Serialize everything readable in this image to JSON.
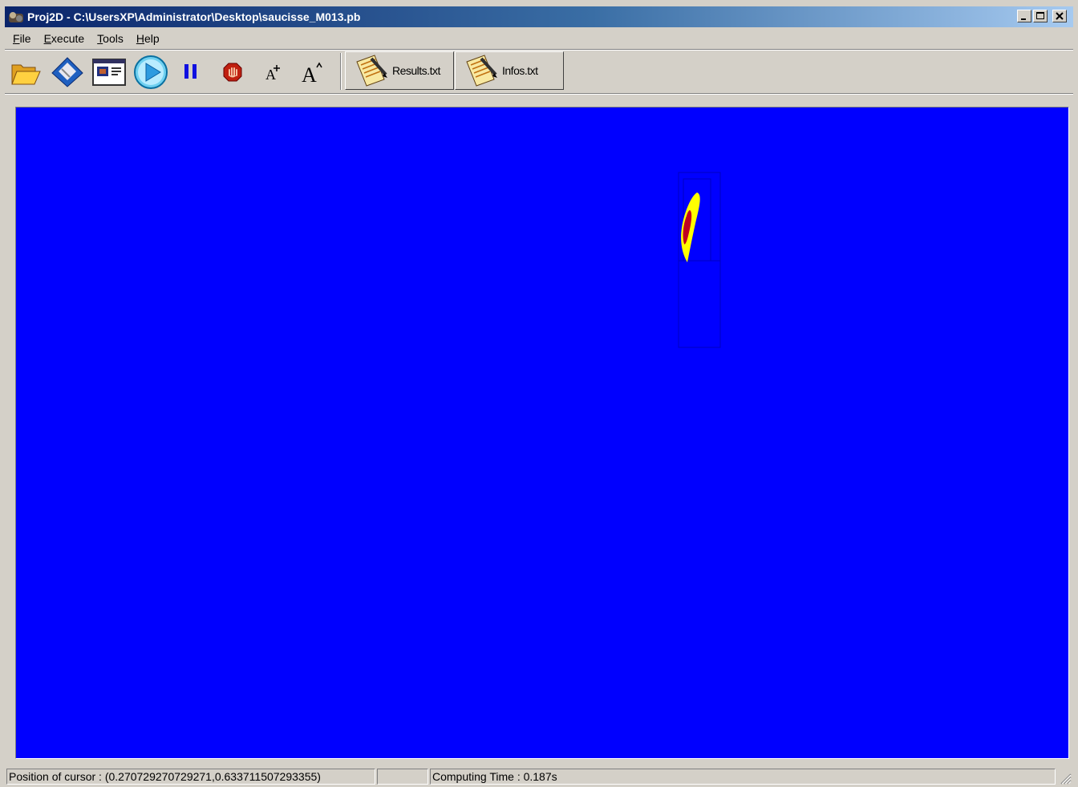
{
  "window": {
    "title": "Proj2D - C:\\UsersXP\\Administrator\\Desktop\\saucisse_M013.pb",
    "minimize_icon": "minimize-icon",
    "maximize_icon": "maximize-icon",
    "close_icon": "close-icon"
  },
  "menu": {
    "file": "File",
    "execute": "Execute",
    "tools": "Tools",
    "help": "Help"
  },
  "toolbar": {
    "open_icon": "folder-open-icon",
    "save_icon": "floppy-disk-icon",
    "display_icon": "display-window-icon",
    "run_icon": "play-icon",
    "pause_icon": "pause-icon",
    "stop_icon": "stop-hand-icon",
    "font_small_icon": "font-increase-small-icon",
    "font_large_icon": "font-increase-large-icon",
    "results_label": "Results.txt",
    "infos_label": "Infos.txt"
  },
  "canvas": {
    "background_color": "#0000ff",
    "shape_outer_color": "#ffff00",
    "shape_inner_color": "#c00020",
    "box_line_color": "#0000c0"
  },
  "status": {
    "cursor_position": "Position of cursor : (0.270729270729271,0.633711507293355)",
    "empty_pane": "",
    "computing_time": "Computing Time : 0.187s"
  }
}
